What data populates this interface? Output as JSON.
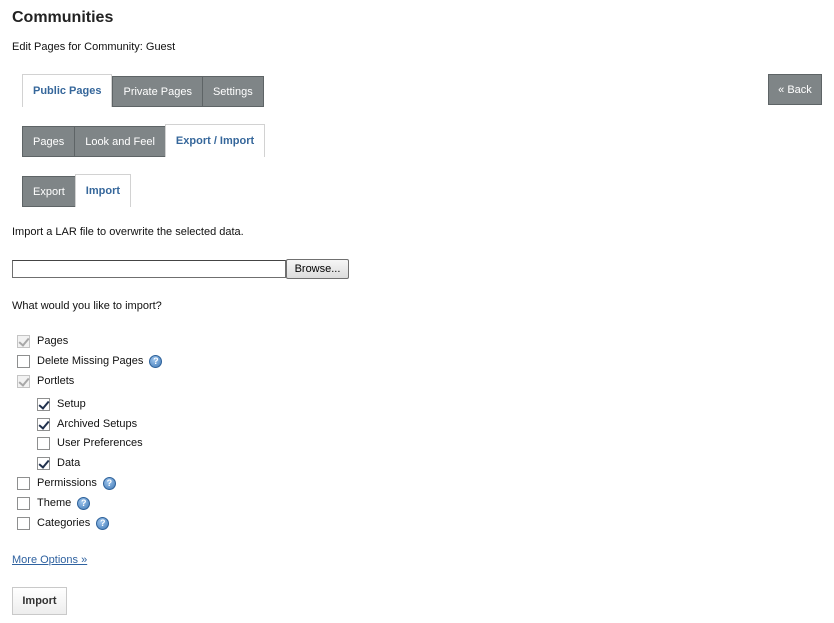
{
  "page": {
    "title": "Communities",
    "subtitle": "Edit Pages for Community: Guest"
  },
  "top_tabs": [
    {
      "label": "Public Pages",
      "active": true
    },
    {
      "label": "Private Pages",
      "active": false
    },
    {
      "label": "Settings",
      "active": false
    }
  ],
  "back_button": {
    "label": "« Back"
  },
  "second_tabs": [
    {
      "label": "Pages",
      "active": false
    },
    {
      "label": "Look and Feel",
      "active": false
    },
    {
      "label": "Export / Import",
      "active": true
    }
  ],
  "third_tabs": [
    {
      "label": "Export",
      "active": false
    },
    {
      "label": "Import",
      "active": true
    }
  ],
  "import_form": {
    "description": "Import a LAR file to overwrite the selected data.",
    "file_value": "",
    "browse_label": "Browse...",
    "question": "What would you like to import?",
    "options": {
      "pages": {
        "label": "Pages",
        "checked": true,
        "disabled": true
      },
      "delete_missing_pages": {
        "label": "Delete Missing Pages",
        "checked": false,
        "help": true
      },
      "portlets": {
        "label": "Portlets",
        "checked": true,
        "disabled": true
      },
      "setup": {
        "label": "Setup",
        "checked": true
      },
      "archived_setups": {
        "label": "Archived Setups",
        "checked": true
      },
      "user_preferences": {
        "label": "User Preferences",
        "checked": false
      },
      "data": {
        "label": "Data",
        "checked": true
      },
      "permissions": {
        "label": "Permissions",
        "checked": false,
        "help": true
      },
      "theme": {
        "label": "Theme",
        "checked": false,
        "help": true
      },
      "categories": {
        "label": "Categories",
        "checked": false,
        "help": true
      }
    },
    "more_options_label": "More Options »",
    "import_button_label": "Import"
  },
  "icons": {
    "help": "help-icon",
    "help_glyph": "?"
  }
}
